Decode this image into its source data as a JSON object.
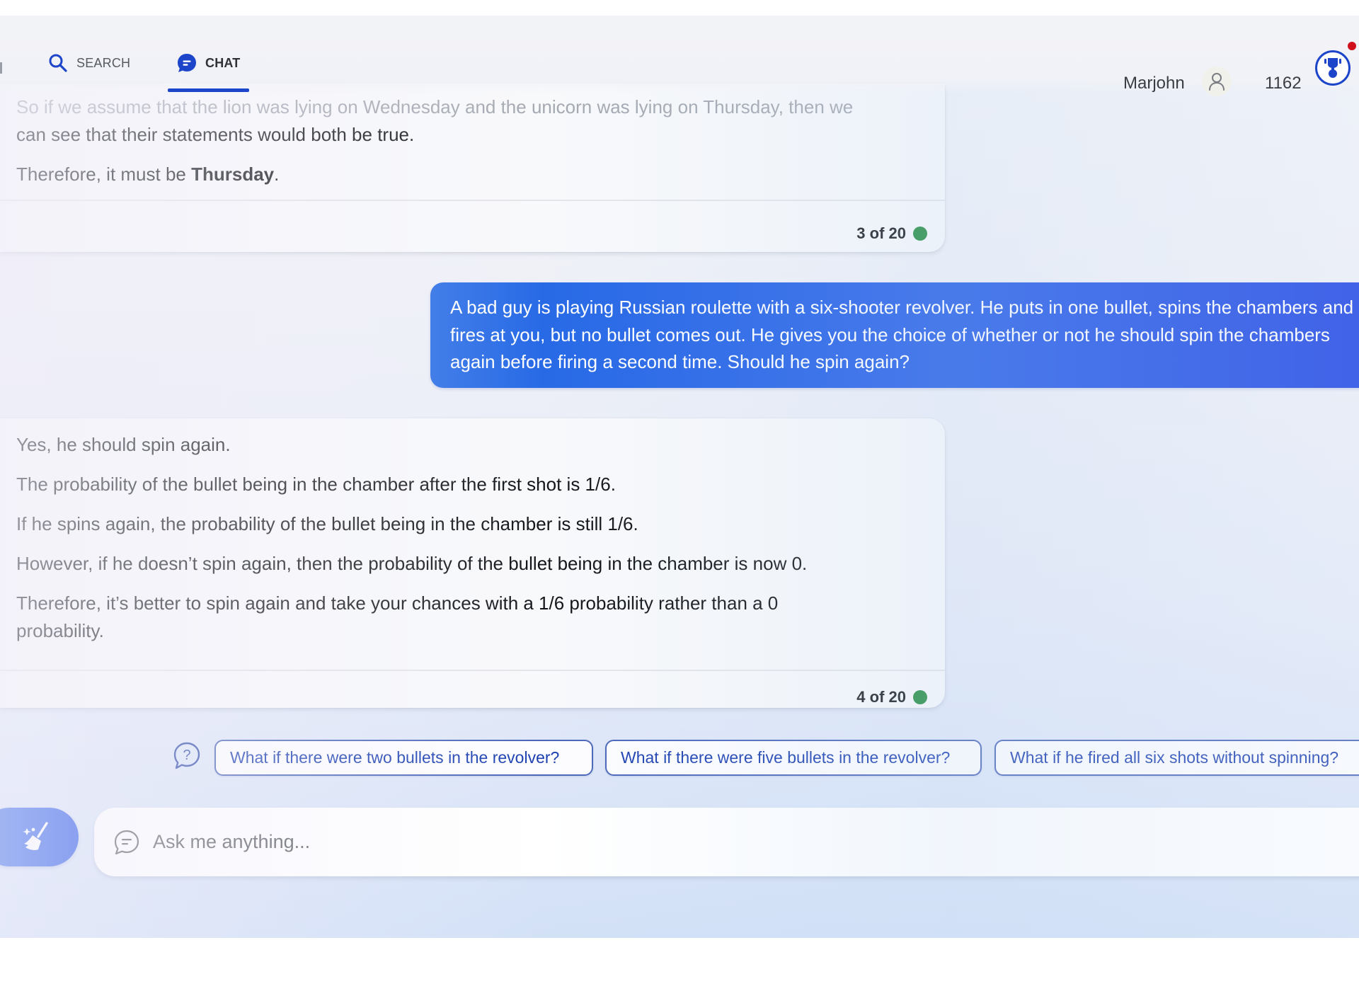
{
  "header": {
    "tabs": [
      {
        "label": "SEARCH",
        "icon": "search-icon",
        "active": false
      },
      {
        "label": "CHAT",
        "icon": "chat-bubble-icon",
        "active": true
      }
    ],
    "user_name": "Marjohn",
    "points": "1162",
    "accent_color": "#1c45c9",
    "notification_color": "#d0101a"
  },
  "conversation": {
    "previous_answer": {
      "faded_line": "So if we assume that the lion was lying on Wednesday and the unicorn was lying on Thursday, then we",
      "line2": "can see that their statements would both be true.",
      "conclusion_prefix": "Therefore, it must be ",
      "conclusion_bold": "Thursday",
      "conclusion_suffix": ".",
      "counter": "3 of 20",
      "status_color": "#228b3e"
    },
    "user_message": "A bad guy is playing Russian roulette with a six-shooter revolver. He puts in one bullet, spins the chambers and fires at you, but no bullet comes out. He gives you the choice of whether or not he should spin the chambers again before firing a second time. Should he spin again?",
    "answer": {
      "paragraphs": [
        "Yes, he should spin again.",
        "The probability of the bullet being in the chamber after the first shot is 1/6.",
        "If he spins again, the probability of the bullet being in the chamber is still 1/6.",
        "However, if he doesn’t spin again, then the probability of the bullet being in the chamber is now 0.",
        "Therefore, it’s better to spin again and take your chances with a 1/6 probability rather than a 0 probability."
      ],
      "counter": "4 of 20",
      "status_color": "#228b3e"
    }
  },
  "suggestions": [
    "What if there were two bullets in the revolver?",
    "What if there were five bullets in the revolver?",
    "What if he fired all six shots without spinning?"
  ],
  "composer": {
    "new_topic_icon": "broom-icon",
    "placeholder": "Ask me anything...",
    "value": ""
  }
}
